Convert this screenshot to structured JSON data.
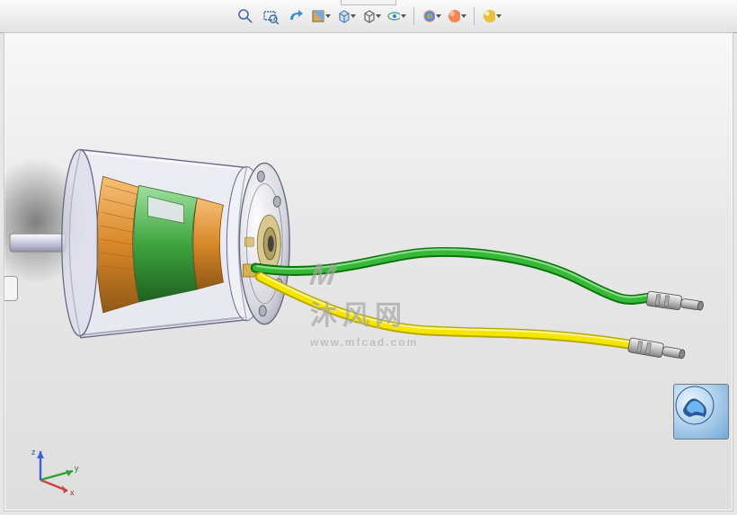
{
  "toolbar": {
    "zoom_to_fit": "zoom-to-fit",
    "zoom_area": "zoom-to-area",
    "prev_view": "previous-view",
    "section_view": "section-view",
    "view_orientation": "view-orientation",
    "display_style": "display-style",
    "hide_show": "hide-show-items",
    "edit_appearance": "edit-appearance",
    "apply_scene": "apply-scene",
    "view_settings": "view-settings"
  },
  "watermark": {
    "text": "沐风网",
    "url": "www.mfcad.com"
  },
  "triad": {
    "x": "x",
    "y": "y",
    "z": "z"
  },
  "model": {
    "wire_green": "#29a329",
    "wire_yellow": "#f5e600",
    "housing": "#e6e6f0",
    "armature_green": "#5fbf5f",
    "armature_orange": "#e08a2b",
    "connector": "#c8c8c8",
    "shadow": "#4a4a4a"
  }
}
